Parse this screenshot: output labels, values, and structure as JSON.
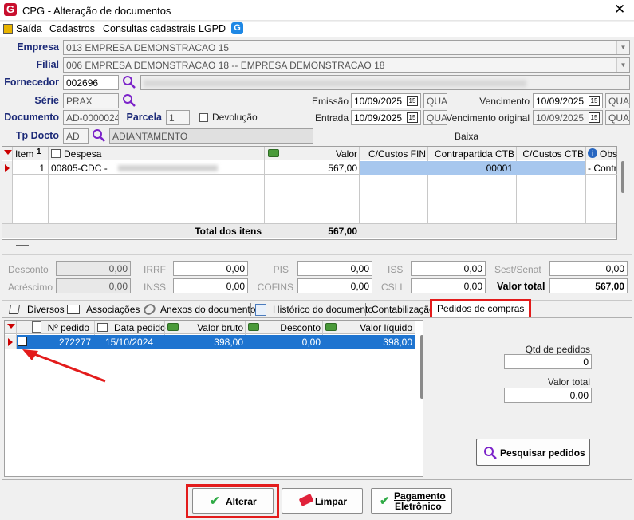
{
  "window": {
    "title": "CPG - Alteração de documentos",
    "close": "✕",
    "logo_letter": "G"
  },
  "menu": {
    "items": [
      "Saída",
      "Cadastros",
      "Consultas cadastrais",
      "LGPD"
    ]
  },
  "header": {
    "empresa_label": "Empresa",
    "empresa_value": "013 EMPRESA DEMONSTRACAO 15",
    "filial_label": "Filial",
    "filial_value": "006 EMPRESA DEMONSTRACAO 18 -- EMPRESA DEMONSTRACAO 18",
    "fornecedor_label": "Fornecedor",
    "fornecedor_code": "002696",
    "serie_label": "Série",
    "serie_value": "PRAX",
    "documento_label": "Documento",
    "documento_value": "AD-0000024",
    "parcela_label": "Parcela",
    "parcela_value": "1",
    "devolucao_label": "Devolução",
    "tpdocto_label": "Tp Docto",
    "tpdocto_code": "AD",
    "tpdocto_desc": "ADIANTAMENTO",
    "emissao_label": "Emissão",
    "emissao_date": "10/09/2025",
    "emissao_dow": "QUA",
    "entrada_label": "Entrada",
    "entrada_date": "10/09/2025",
    "entrada_dow": "QUA",
    "vencimento_label": "Vencimento",
    "vencimento_date": "10/09/2025",
    "vencimento_dow": "QUA",
    "vencorig_label": "Vencimento original",
    "vencorig_date": "10/09/2025",
    "vencorig_dow": "QUA",
    "baixa_label": "Baixa",
    "calendar_glyph": "15"
  },
  "items_grid": {
    "headers": {
      "item": "Item",
      "item_sort": "1",
      "despesa": "Despesa",
      "valor": "Valor",
      "cc_fin": "C/Custos FIN",
      "contrapartida": "Contrapartida CTB",
      "cc_ctb": "C/Custos CTB",
      "obs": "Obs"
    },
    "row": {
      "item": "1",
      "despesa": "00805-CDC -",
      "valor": "567,00",
      "contrapartida": "00001",
      "obs": "- Contra"
    },
    "total_label": "Total dos itens",
    "total_value": "567,00"
  },
  "totals": {
    "desconto_label": "Desconto",
    "desconto": "0,00",
    "acrescimo_label": "Acréscimo",
    "acrescimo": "0,00",
    "irrf_label": "IRRF",
    "irrf": "0,00",
    "inss_label": "INSS",
    "inss": "0,00",
    "pis_label": "PIS",
    "pis": "0,00",
    "cofins_label": "COFINS",
    "cofins": "0,00",
    "iss_label": "ISS",
    "iss": "0,00",
    "csll_label": "CSLL",
    "csll": "0,00",
    "sestsenat_label": "Sest/Senat",
    "sestsenat": "0,00",
    "valortotal_label": "Valor total",
    "valortotal": "567,00"
  },
  "tabs": [
    "Diversos",
    "Associações",
    "Anexos do documento",
    "Histórico do documento",
    "Contabilização",
    "Pedidos de compras"
  ],
  "orders_grid": {
    "headers": {
      "num": "Nº pedido",
      "data": "Data pedido",
      "bruto": "Valor bruto",
      "desconto": "Desconto",
      "liquido": "Valor líquido"
    },
    "rows": [
      {
        "num": "272277",
        "data": "15/10/2024",
        "bruto": "398,00",
        "desconto": "0,00",
        "liquido": "398,00"
      }
    ]
  },
  "orders_side": {
    "qtd_label": "Qtd de pedidos",
    "qtd_value": "0",
    "valortotal_label": "Valor total",
    "valortotal_value": "0,00",
    "search_button": "Pesquisar pedidos"
  },
  "footer": {
    "alterar": "Alterar",
    "limpar": "Limpar",
    "pagamento_1": "Pagamento",
    "pagamento_2": "Eletrônico"
  },
  "colors": {
    "highlight": "#e31b1b",
    "selection": "#1e74d0",
    "label": "#1c2a78"
  }
}
